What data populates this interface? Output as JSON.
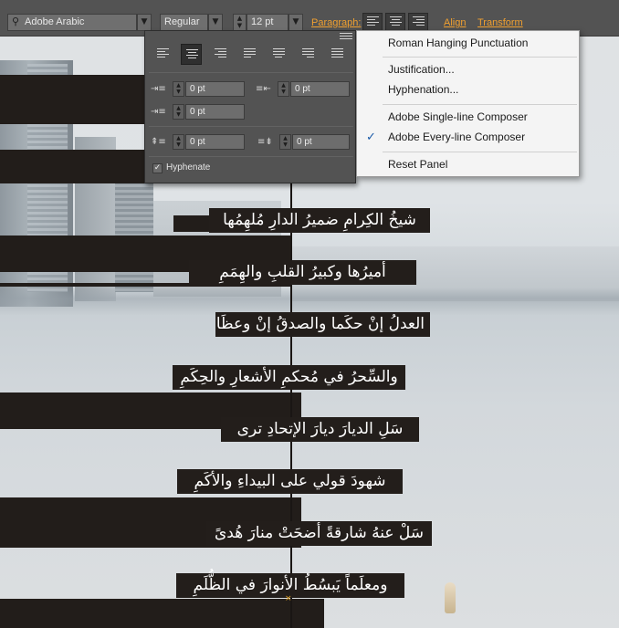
{
  "control_bar": {
    "font_family": "Adobe Arabic",
    "font_style": "Regular",
    "font_size": "12 pt",
    "paragraph_label": "Paragraph:",
    "align_label": "Align",
    "transform_label": "Transform"
  },
  "paragraph_panel": {
    "indent_left": "0 pt",
    "indent_right": "0 pt",
    "indent_first_line": "0 pt",
    "space_before": "0 pt",
    "space_after": "0 pt",
    "hyphenate_label": "Hyphenate",
    "hyphenate_checked": true,
    "active_alignment": "align-center"
  },
  "flyout_menu": {
    "items": [
      "Roman Hanging Punctuation",
      "Justification...",
      "Hyphenation...",
      "Adobe Single-line Composer",
      "Adobe Every-line Composer",
      "Reset Panel"
    ],
    "checked_item": "Adobe Every-line Composer"
  },
  "poem_lines": [
    "شيخُ الكِرامِ ضميرُ الدارِ مُلهِمُها",
    "أميرُها وكبيرُ القلبِ والهِمَمِ",
    "العدلُ إنْ حكَما والصدقُ إنْ وعظَا",
    "والسِّحرُ في مُحكمِ الأشعارِ والحِكَمِ",
    "سَلِ الديارَ ديارَ الإتحادِ ترى",
    "شهودَ قولي على البيداءِ والأكَمِ",
    "سَلْ عنهُ شارقةً أضحَتْ منارَ هُدىً",
    "ومعلَماً يَبسُطُ الأنوارَ في الظُّلَمِ"
  ],
  "colors": {
    "accent_orange": "#f0a030",
    "check_blue": "#1a5aa8",
    "panel_gray": "#535353",
    "text_block": "#231e1b"
  }
}
